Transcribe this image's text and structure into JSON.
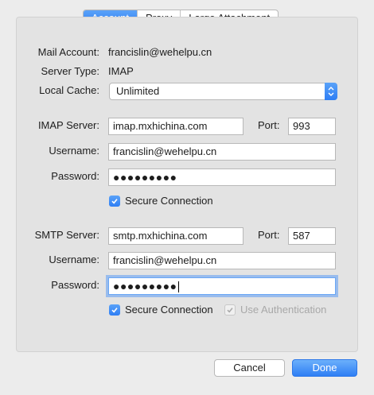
{
  "tabs": [
    "Account",
    "Proxy",
    "Large Attachment"
  ],
  "account": {
    "mail_account_label": "Mail Account:",
    "mail_account_value": "francislin@wehelpu.cn",
    "server_type_label": "Server Type:",
    "server_type_value": "IMAP",
    "local_cache_label": "Local Cache:",
    "local_cache_value": "Unlimited"
  },
  "imap": {
    "server_label": "IMAP Server:",
    "server_value": "imap.mxhichina.com",
    "port_label": "Port:",
    "port_value": "993",
    "username_label": "Username:",
    "username_value": "francislin@wehelpu.cn",
    "password_label": "Password:",
    "password_value": "●●●●●●●●●",
    "secure_label": "Secure Connection"
  },
  "smtp": {
    "server_label": "SMTP Server:",
    "server_value": "smtp.mxhichina.com",
    "port_label": "Port:",
    "port_value": "587",
    "username_label": "Username:",
    "username_value": "francislin@wehelpu.cn",
    "password_label": "Password:",
    "password_value": "●●●●●●●●●",
    "secure_label": "Secure Connection",
    "auth_label": "Use Authentication"
  },
  "buttons": {
    "cancel": "Cancel",
    "done": "Done"
  },
  "colors": {
    "accent": "#2e7ef4",
    "panel": "#e3e3e3",
    "window": "#ececec"
  }
}
